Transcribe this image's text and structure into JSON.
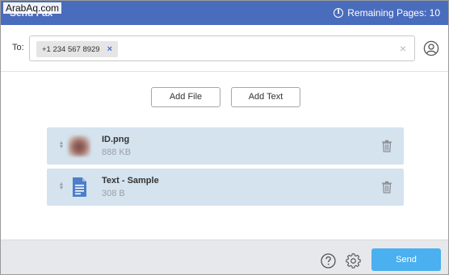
{
  "header": {
    "title": "Send Fax",
    "remaining_label": "Remaining Pages: 10",
    "watermark": "ArabAq.com"
  },
  "to_row": {
    "label": "To:",
    "recipients": [
      {
        "number": "+1 234 567 8929",
        "remove_symbol": "×"
      }
    ],
    "clear_symbol": "×"
  },
  "actions": {
    "add_file_label": "Add File",
    "add_text_label": "Add Text"
  },
  "files": [
    {
      "name": "ID.png",
      "size": "888 KB",
      "icon": "image-thumbnail"
    },
    {
      "name": "Text - Sample",
      "size": "308 B",
      "icon": "document-icon"
    }
  ],
  "footer": {
    "send_label": "Send"
  },
  "colors": {
    "header_bg": "#4a6cbc",
    "row_bg": "#d5e3ef",
    "send_bg": "#4ab0ef",
    "footer_bg": "#e7e8ec"
  }
}
